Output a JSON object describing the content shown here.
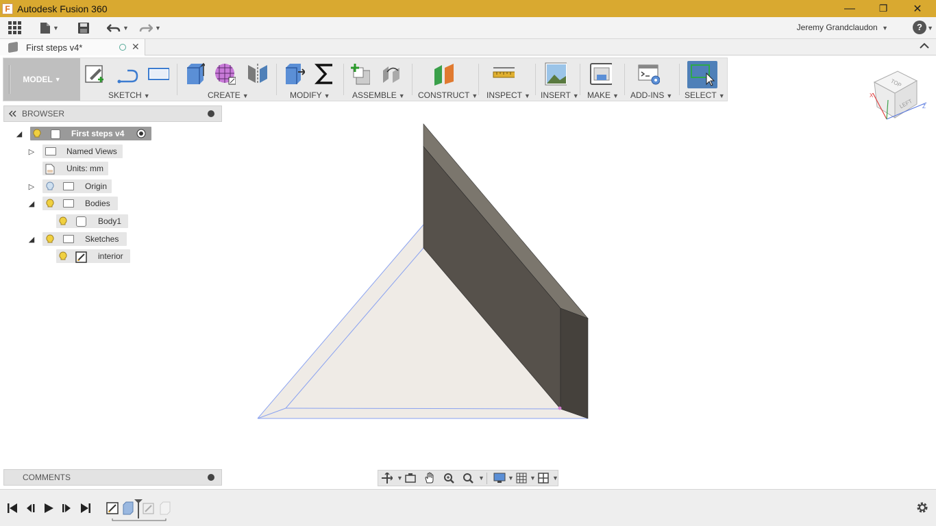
{
  "window": {
    "app_title": "Autodesk Fusion 360",
    "minimize": "—",
    "restore": "❐",
    "close": "✕"
  },
  "appbar": {
    "user": "Jeremy Grandclaudon",
    "help": "?"
  },
  "document_tab": {
    "title": "First steps v4*",
    "close": "✕"
  },
  "toolbar": {
    "workspace": "MODEL",
    "groups": [
      {
        "label": "SKETCH"
      },
      {
        "label": "CREATE"
      },
      {
        "label": "MODIFY"
      },
      {
        "label": "ASSEMBLE"
      },
      {
        "label": "CONSTRUCT"
      },
      {
        "label": "INSPECT"
      },
      {
        "label": "INSERT"
      },
      {
        "label": "MAKE"
      },
      {
        "label": "ADD-INS"
      },
      {
        "label": "SELECT"
      }
    ]
  },
  "browser": {
    "header": "BROWSER",
    "root": "First steps v4",
    "items": [
      {
        "label": "Named Views"
      },
      {
        "label": "Units: mm"
      },
      {
        "label": "Origin"
      },
      {
        "label": "Bodies"
      },
      {
        "label": "Body1"
      },
      {
        "label": "Sketches"
      },
      {
        "label": "interior"
      }
    ]
  },
  "viewcube": {
    "top": "TOP",
    "left": "LEFT"
  },
  "comments": {
    "label": "COMMENTS"
  },
  "colors": {
    "titlebar": "#d9a930",
    "body_dark": "#56514b",
    "body_top": "#7b766d",
    "sketch_fill": "#efebe6",
    "sketch_line": "#8aa2f0",
    "select_blue": "#4f80b8"
  }
}
